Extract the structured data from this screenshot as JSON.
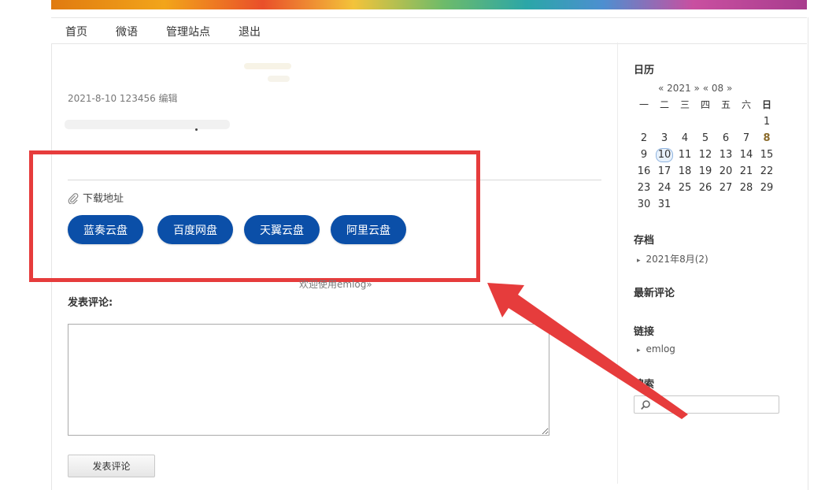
{
  "nav": {
    "items": [
      "首页",
      "微语",
      "管理站点",
      "退出"
    ]
  },
  "post": {
    "meta": "2021-8-10 123456 编辑"
  },
  "downloads": {
    "title": "下载地址",
    "buttons": [
      "蓝奏云盘",
      "百度网盘",
      "天翼云盘",
      "阿里云盘"
    ]
  },
  "footer": {
    "welcome": "欢迎使用emlog»"
  },
  "comment": {
    "title": "发表评论:",
    "submit_label": "发表评论",
    "textarea_value": ""
  },
  "sidebar": {
    "calendar": {
      "title": "日历",
      "prev_year": "«",
      "year": "2021",
      "next_year": "»",
      "prev_month": "«",
      "month": "08",
      "next_month": "»",
      "weekdays": [
        "一",
        "二",
        "三",
        "四",
        "五",
        "六",
        "日"
      ],
      "weeks": [
        [
          "",
          "",
          "",
          "",
          "",
          "",
          "1"
        ],
        [
          "2",
          "3",
          "4",
          "5",
          "6",
          "7",
          "8"
        ],
        [
          "9",
          "10",
          "11",
          "12",
          "13",
          "14",
          "15"
        ],
        [
          "16",
          "17",
          "18",
          "19",
          "20",
          "21",
          "22"
        ],
        [
          "23",
          "24",
          "25",
          "26",
          "27",
          "28",
          "29"
        ],
        [
          "30",
          "31",
          "",
          "",
          "",
          "",
          ""
        ]
      ],
      "highlighted_day": "10",
      "bold_day": "8"
    },
    "archive": {
      "title": "存档",
      "items": [
        "2021年8月(2)"
      ]
    },
    "recent_comments": {
      "title": "最新评论"
    },
    "links": {
      "title": "链接",
      "items": [
        "emlog"
      ]
    },
    "search": {
      "title": "搜索",
      "value": "",
      "placeholder": ""
    }
  },
  "colors": {
    "button_blue": "#0b4fa8",
    "annotation_red": "#e63c3c"
  }
}
